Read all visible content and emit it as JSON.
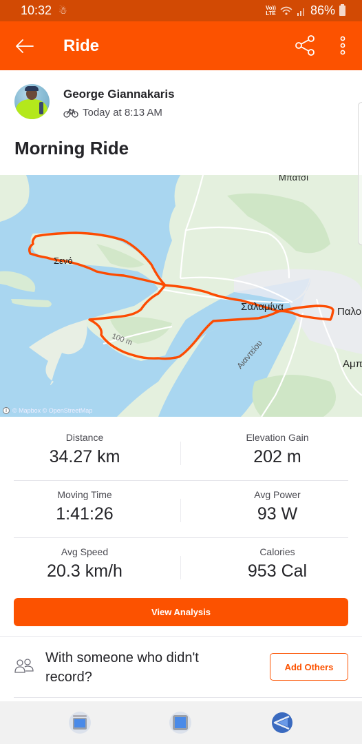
{
  "status_bar": {
    "time": "10:32",
    "network": "VoLTE",
    "battery": "86%"
  },
  "app_bar": {
    "title": "Ride",
    "back_icon": "arrow-left-icon",
    "share_icon": "share-icon",
    "more_icon": "more-vertical-icon"
  },
  "activity": {
    "athlete_name": "George Giannakaris",
    "sport_icon": "bike-icon",
    "timestamp": "Today at 8:13 AM",
    "title": "Morning Ride"
  },
  "map": {
    "labels": {
      "north_town": "Μπατσί",
      "west_town": "Σενό",
      "center_town": "Σαλαμίνα",
      "east_town": "Παλο",
      "southeast_town": "Αμπ",
      "street": "Αιαντείου",
      "contour": "100 m"
    },
    "attribution": "© Mapbox © OpenStreetMap",
    "route_color": "#FC4C02"
  },
  "stats": [
    [
      {
        "label": "Distance",
        "value": "34.27 km"
      },
      {
        "label": "Elevation Gain",
        "value": "202 m"
      }
    ],
    [
      {
        "label": "Moving Time",
        "value": "1:41:26"
      },
      {
        "label": "Avg Power",
        "value": "93 W"
      }
    ],
    [
      {
        "label": "Avg Speed",
        "value": "20.3 km/h"
      },
      {
        "label": "Calories",
        "value": "953 Cal"
      }
    ]
  ],
  "actions": {
    "view_analysis": "View Analysis",
    "add_others_prompt": "With someone who didn't record?",
    "add_others_button": "Add Others"
  },
  "nav_bar": {
    "recents": "recents-icon",
    "home": "home-icon",
    "back": "back-icon"
  },
  "colors": {
    "brand": "#FC5200",
    "status_bar": "#D24A04",
    "water": "#A9D6F0",
    "land": "#E4F0DE"
  }
}
